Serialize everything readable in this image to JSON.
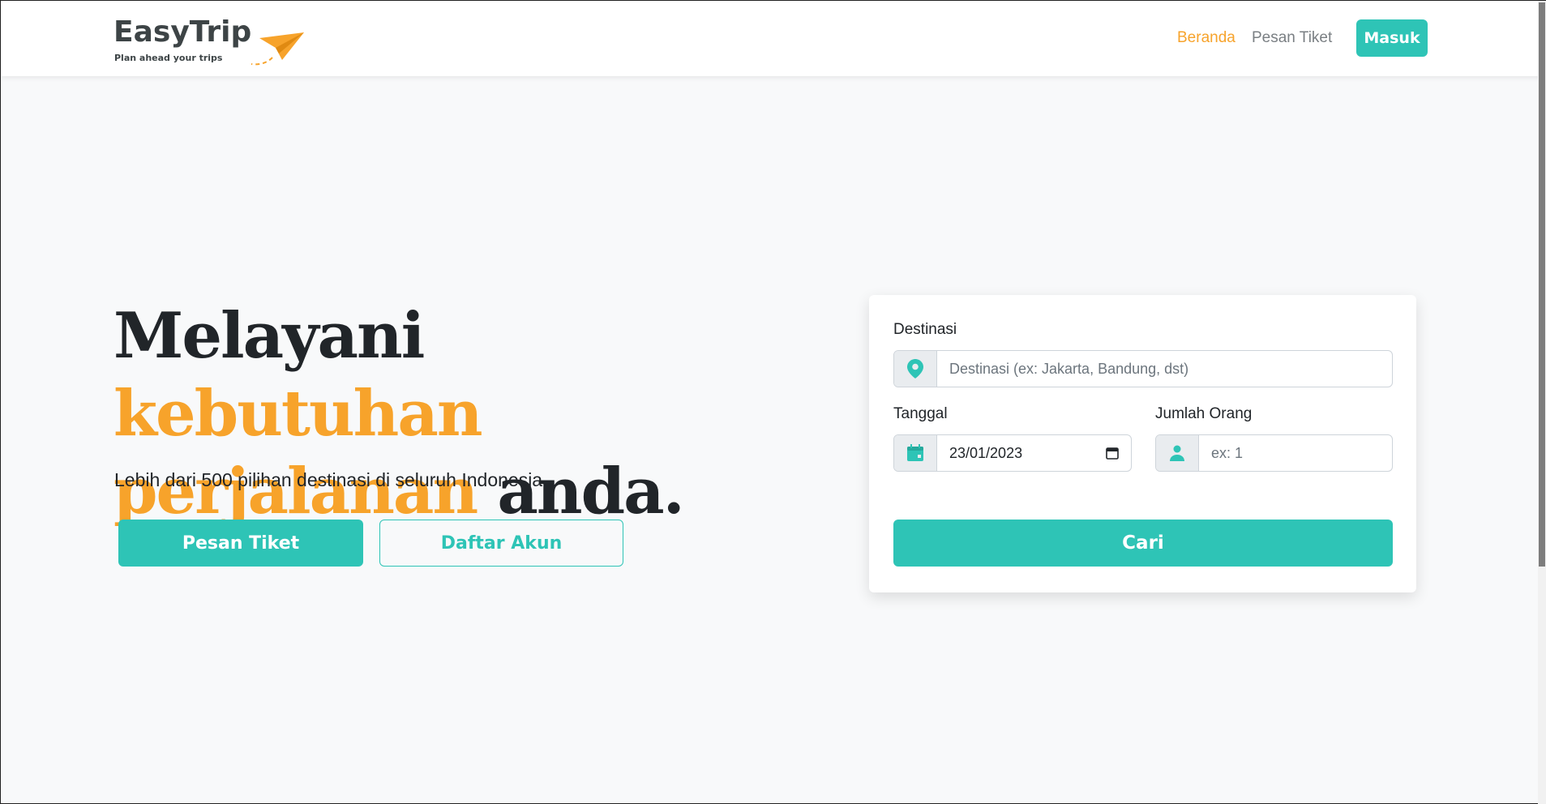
{
  "brand": {
    "name": "EasyTrip",
    "tagline": "Plan ahead your trips",
    "logo_icon": "paper-plane-icon",
    "accent_color": "#f7a32b"
  },
  "nav": {
    "links": [
      {
        "label": "Beranda",
        "active": true
      },
      {
        "label": "Pesan Tiket",
        "active": false
      }
    ],
    "login_label": "Masuk"
  },
  "hero": {
    "title_part1": "Melayani",
    "title_accent": "kebutuhan perjalanan",
    "title_part2": "anda.",
    "subtitle": "Lebih dari 500 pilihan destinasi di seluruh Indonesia.",
    "primary_button": "Pesan Tiket",
    "secondary_button": "Daftar Akun"
  },
  "search": {
    "destination_label": "Destinasi",
    "destination_placeholder": "Destinasi (ex: Jakarta, Bandung, dst)",
    "destination_icon": "map-pin-icon",
    "date_label": "Tanggal",
    "date_value": "23/01/2023",
    "date_icon": "calendar-icon",
    "people_label": "Jumlah Orang",
    "people_placeholder": "ex: 1",
    "people_icon": "person-icon",
    "submit_label": "Cari"
  },
  "colors": {
    "primary": "#2ec4b6",
    "accent": "#f7a32b",
    "text": "#212529"
  }
}
